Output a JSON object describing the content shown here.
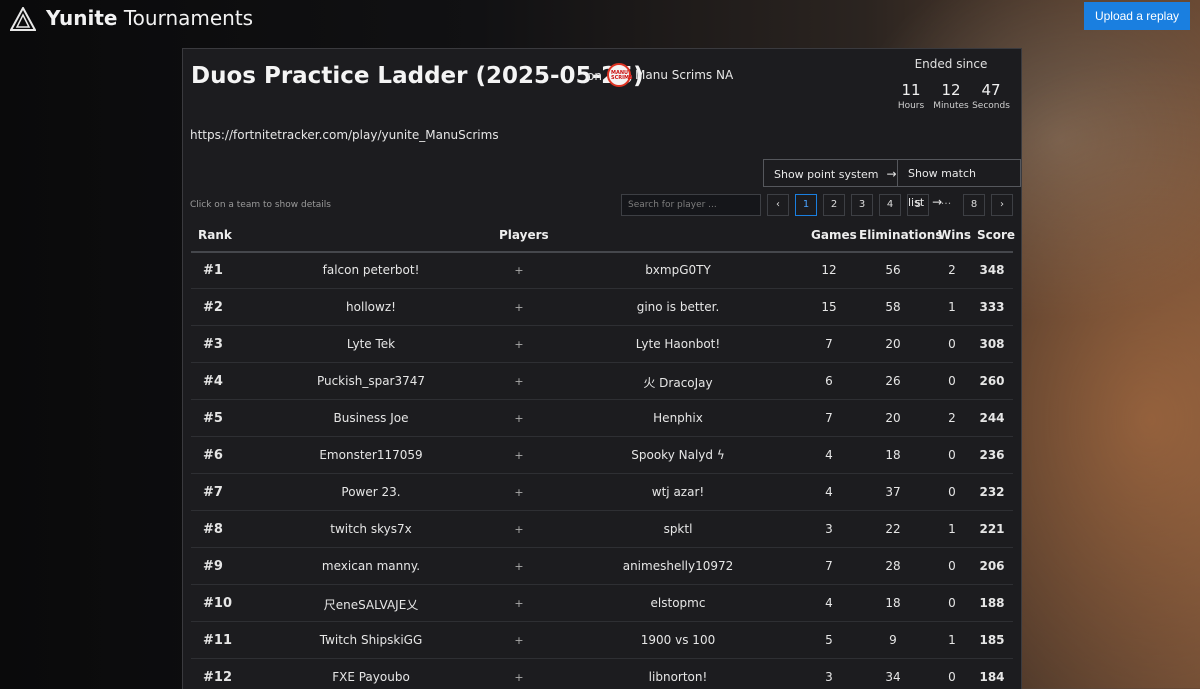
{
  "header": {
    "brand_bold": "Yunite",
    "brand_rest": " Tournaments",
    "upload_label": "Upload a replay"
  },
  "tournament": {
    "title": "Duos Practice Ladder (2025-05-25)",
    "on_label": "on",
    "org_logo_text": "MANU SCRIMS",
    "org_name": "Manu Scrims NA",
    "url": "https://fortnitetracker.com/play/yunite_ManuScrims"
  },
  "timer": {
    "label": "Ended since",
    "hours": "11",
    "hours_label": "Hours",
    "minutes": "12",
    "minutes_label": "Minutes",
    "seconds": "47",
    "seconds_label": "Seconds"
  },
  "actions": {
    "point_system": "Show point system",
    "match_list": "Show match list",
    "arrow": "→"
  },
  "hint": "Click on a team to show details",
  "search": {
    "placeholder": "Search for player ..."
  },
  "pagination": {
    "prev": "‹",
    "pages": [
      "1",
      "2",
      "3",
      "4",
      "5"
    ],
    "dots": "···",
    "last": "8",
    "next": "›"
  },
  "columns": {
    "rank": "Rank",
    "players": "Players",
    "games": "Games",
    "eliminations": "Eliminations",
    "wins": "Wins",
    "score": "Score"
  },
  "plus_sign": "+",
  "rows": [
    {
      "rank": "#1",
      "p1": "falcon peterbot!",
      "p2": "bxmpG0TY",
      "games": "12",
      "elims": "56",
      "wins": "2",
      "score": "348"
    },
    {
      "rank": "#2",
      "p1": "hollowz!",
      "p2": "gino is better.",
      "games": "15",
      "elims": "58",
      "wins": "1",
      "score": "333"
    },
    {
      "rank": "#3",
      "p1": "Lyte Tek",
      "p2": "Lyte Haonbot!",
      "games": "7",
      "elims": "20",
      "wins": "0",
      "score": "308"
    },
    {
      "rank": "#4",
      "p1": "Puckish_spar3747",
      "p2": "火 DracoJay",
      "games": "6",
      "elims": "26",
      "wins": "0",
      "score": "260"
    },
    {
      "rank": "#5",
      "p1": "Business Joe",
      "p2": "Henphix",
      "games": "7",
      "elims": "20",
      "wins": "2",
      "score": "244"
    },
    {
      "rank": "#6",
      "p1": "Emonster117059",
      "p2": "Spooky Nalyd ϟ",
      "games": "4",
      "elims": "18",
      "wins": "0",
      "score": "236"
    },
    {
      "rank": "#7",
      "p1": "Power 23.",
      "p2": "wtj azar!",
      "games": "4",
      "elims": "37",
      "wins": "0",
      "score": "232"
    },
    {
      "rank": "#8",
      "p1": "twitch skys7x",
      "p2": "spktl",
      "games": "3",
      "elims": "22",
      "wins": "1",
      "score": "221"
    },
    {
      "rank": "#9",
      "p1": "mexican manny.",
      "p2": "animeshelly10972",
      "games": "7",
      "elims": "28",
      "wins": "0",
      "score": "206"
    },
    {
      "rank": "#10",
      "p1": "尺eneSALVAJE乂",
      "p2": "elstopmc",
      "games": "4",
      "elims": "18",
      "wins": "0",
      "score": "188"
    },
    {
      "rank": "#11",
      "p1": "Twitch ShipskiGG",
      "p2": "1900 vs 100",
      "games": "5",
      "elims": "9",
      "wins": "1",
      "score": "185"
    },
    {
      "rank": "#12",
      "p1": "FXE Payoubo",
      "p2": "libnorton!",
      "games": "3",
      "elims": "34",
      "wins": "0",
      "score": "184"
    }
  ]
}
